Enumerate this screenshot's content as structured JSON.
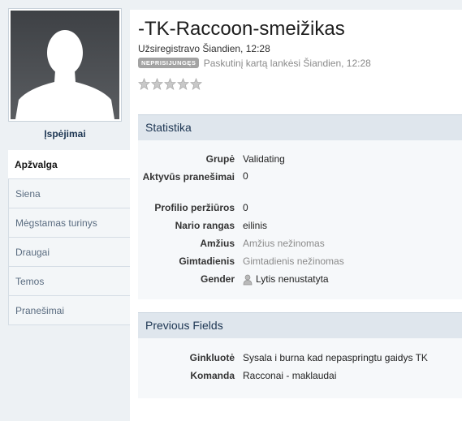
{
  "sidebar": {
    "warnings_label": "Įspėjimai",
    "tabs": [
      {
        "label": "Apžvalga"
      },
      {
        "label": "Siena"
      },
      {
        "label": "Mėgstamas turinys"
      },
      {
        "label": "Draugai"
      },
      {
        "label": "Temos"
      },
      {
        "label": "Pranešimai"
      }
    ]
  },
  "profile": {
    "name": "-TK-Raccoon-smeižikas",
    "registered": "Užsiregistravo Šiandien, 12:28",
    "status_badge": "NEPRISIJUNGĘS",
    "last_visit": "Paskutinį kartą lankėsi Šiandien, 12:28",
    "rating_stars": 5
  },
  "statistics": {
    "title": "Statistika",
    "rows": [
      {
        "label": "Grupė",
        "value": "Validating"
      },
      {
        "label": "Aktyvūs pranešimai",
        "value": "0"
      },
      {
        "label": "Profilio peržiūros",
        "value": "0"
      },
      {
        "label": "Nario rangas",
        "value": "eilinis"
      },
      {
        "label": "Amžius",
        "value": "Amžius nežinomas"
      },
      {
        "label": "Gimtadienis",
        "value": "Gimtadienis nežinomas"
      },
      {
        "label": "Gender",
        "value": "Lytis nenustatyta"
      }
    ]
  },
  "previous_fields": {
    "title": "Previous Fields",
    "rows": [
      {
        "label": "Ginkluotė",
        "value": "Sysala i burna kad nepaspringtu gaidys TK"
      },
      {
        "label": "Komanda",
        "value": "Racconai - maklaudai"
      }
    ]
  },
  "colors": {
    "section_header_bg": "#dfe6ed",
    "badge_bg": "#a3a3a3",
    "page_bg": "#edf1f4"
  }
}
